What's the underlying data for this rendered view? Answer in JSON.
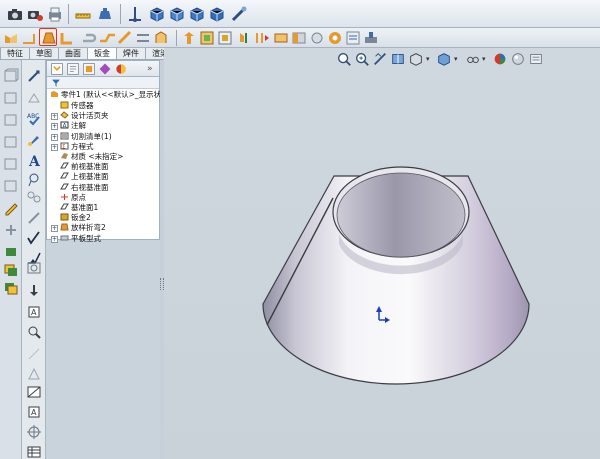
{
  "tabs": [
    {
      "label": "特征",
      "active": false
    },
    {
      "label": "草图",
      "active": false
    },
    {
      "label": "曲面",
      "active": false
    },
    {
      "label": "钣金",
      "active": true
    },
    {
      "label": "焊件",
      "active": false
    },
    {
      "label": "渲染工具",
      "active": false
    }
  ],
  "tree": {
    "root": "零件1 (默认<<默认>_显示状态",
    "nodes": [
      {
        "label": "传感器",
        "expander": "",
        "icon": "sensor-icon"
      },
      {
        "label": "设计活页夹",
        "expander": "+",
        "icon": "binder-icon"
      },
      {
        "label": "注解",
        "expander": "+",
        "icon": "annotation-icon"
      },
      {
        "label": "切割清单(1)",
        "expander": "+",
        "icon": "cutlist-icon"
      },
      {
        "label": "方程式",
        "expander": "+",
        "icon": "equation-icon"
      },
      {
        "label": "材质 <未指定>",
        "expander": "",
        "icon": "material-icon"
      },
      {
        "label": "前视基准面",
        "expander": "",
        "icon": "plane-icon"
      },
      {
        "label": "上视基准面",
        "expander": "",
        "icon": "plane-icon"
      },
      {
        "label": "右视基准面",
        "expander": "",
        "icon": "plane-icon"
      },
      {
        "label": "原点",
        "expander": "",
        "icon": "origin-icon"
      },
      {
        "label": "基准面1",
        "expander": "",
        "icon": "plane-icon"
      },
      {
        "label": "钣金2",
        "expander": "",
        "icon": "sheetmetal-icon"
      },
      {
        "label": "放样折弯2",
        "expander": "+",
        "icon": "loftbend-icon"
      },
      {
        "label": "平板型式",
        "expander": "+",
        "icon": "flatpattern-icon"
      }
    ]
  },
  "colors": {
    "accent": "#2f6fb8",
    "viewport_bg": "#c9d1d9",
    "cone_light": "#e9e7ee",
    "cone_dark": "#a59fb4"
  }
}
